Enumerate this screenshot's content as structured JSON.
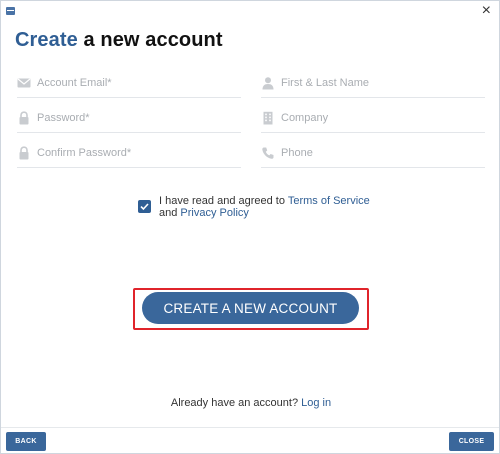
{
  "window": {
    "close_glyph": "×",
    "app_icon": "app-icon"
  },
  "heading": {
    "accent": "Create",
    "rest": " a new account"
  },
  "form": {
    "account_email": {
      "placeholder": "Account Email*",
      "value": "",
      "icon": "envelope-icon"
    },
    "full_name": {
      "placeholder": "First & Last Name",
      "value": "",
      "icon": "user-icon"
    },
    "password": {
      "placeholder": "Password*",
      "value": "",
      "icon": "lock-icon"
    },
    "company": {
      "placeholder": "Company",
      "value": "",
      "icon": "building-icon"
    },
    "confirm_password": {
      "placeholder": "Confirm Password*",
      "value": "",
      "icon": "lock-icon"
    },
    "phone": {
      "placeholder": "Phone",
      "value": "",
      "icon": "phone-icon"
    }
  },
  "agreement": {
    "checked": true,
    "text_prefix": "I have read and agreed to ",
    "terms_link": "Terms of Service",
    "text_mid": "and ",
    "privacy_link": "Privacy Policy"
  },
  "create_button": {
    "label": "CREATE A NEW ACCOUNT"
  },
  "login": {
    "prompt": "Already have an account? ",
    "link": "Log in"
  },
  "footer": {
    "back_label": "BACK",
    "close_label": "CLOSE"
  },
  "colors": {
    "accent": "#2f5e94",
    "button": "#3a679b",
    "highlight": "#e0242b"
  }
}
